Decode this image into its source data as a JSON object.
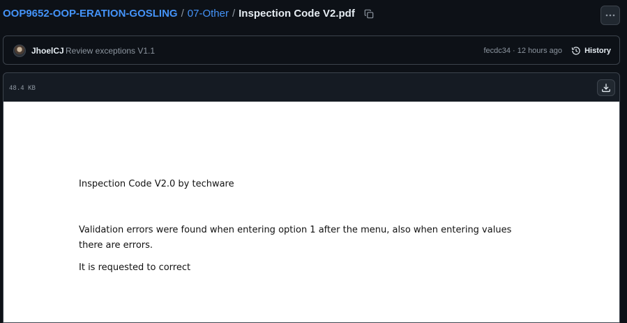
{
  "breadcrumb": {
    "repo": "OOP9652-OOP-ERATION-GOSLING",
    "separator": "/",
    "folder": "07-Other",
    "file": "Inspection Code V2.pdf"
  },
  "icons": {
    "copy": "copy-icon",
    "more": "kebab-horizontal-icon",
    "history": "history-icon",
    "download": "download-icon"
  },
  "commit": {
    "author": "JhoelCJ",
    "message": "Review exceptions V1.1",
    "meta": "fecdc34 · 12 hours ago",
    "history_label": "History"
  },
  "file": {
    "size": "48.4 KB"
  },
  "pdf": {
    "lines": [
      "Inspection Code V2.0 by techware",
      "Validation errors were found when entering option 1 after the menu, also when entering values",
      "there are errors.",
      "It is requested to correct"
    ]
  },
  "colors": {
    "background": "#0d1117",
    "link": "#4493f8",
    "border": "#3d444d",
    "muted": "#8d96a0",
    "pdf_page": "#ffffff"
  }
}
